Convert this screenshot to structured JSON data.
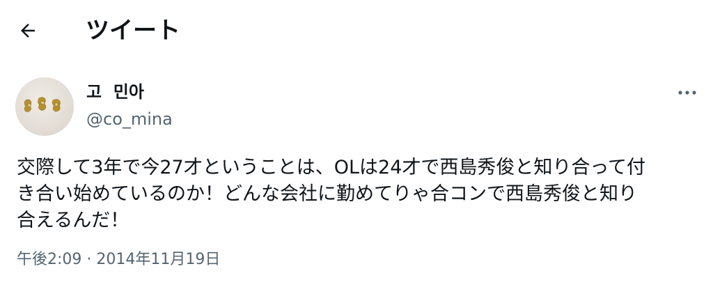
{
  "header": {
    "title": "ツイート",
    "back_icon": "arrow-left-icon"
  },
  "tweet": {
    "author": {
      "display_name": "고  민아",
      "handle": "@co_mina",
      "avatar_icon": "avatar-gold-ornament"
    },
    "more_icon": "more-horizontal-icon",
    "text": "交際して3年で今27才ということは、OLは24才で西島秀俊と知り合って付\nき合い始めているのか！どんな会社に勤めてりゃ合コンで西島秀俊と知り\n合えるんだ！",
    "timestamp": "午後2:09 · 2014年11月19日"
  },
  "colors": {
    "text_primary": "#0f1419",
    "text_secondary": "#536471",
    "background": "#ffffff"
  }
}
